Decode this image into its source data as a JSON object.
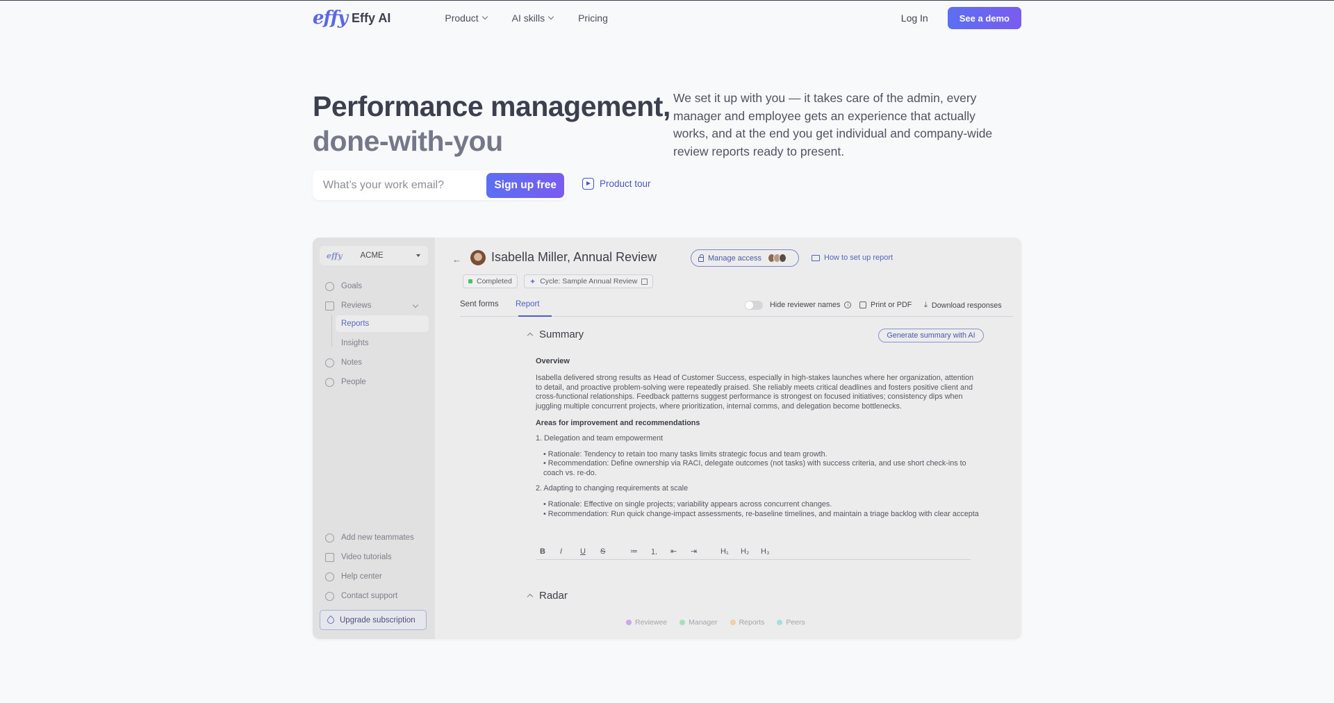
{
  "nav": {
    "logo_mark": "effy",
    "logo_text": "Effy AI",
    "links": [
      {
        "label": "Product",
        "dropdown": true
      },
      {
        "label": "AI skills",
        "dropdown": true
      },
      {
        "label": "Pricing",
        "dropdown": false
      }
    ],
    "login_label": "Log In",
    "demo_label": "See a demo"
  },
  "hero": {
    "title_line1": "Performance management,",
    "title_line2": "done-with-you",
    "description": "We set it up with you — it takes care of the admin, every manager and employee gets an experience that actually works, and at the end you get individual and company-wide review reports ready to present.",
    "email_placeholder": "What’s your work email?",
    "signup_label": "Sign up free",
    "tour_label": "Product tour"
  },
  "app": {
    "sidebar": {
      "org_logo": "effy",
      "org_name": "ACME",
      "items": [
        {
          "label": "Goals",
          "icon": "target-icon"
        },
        {
          "label": "Reviews",
          "icon": "clipboard-icon"
        },
        {
          "label": "Notes",
          "icon": "chat-icon"
        },
        {
          "label": "People",
          "icon": "people-icon"
        }
      ],
      "subitems": [
        {
          "label": "Reports",
          "active": true
        },
        {
          "label": "Insights",
          "active": false
        }
      ],
      "bottom_items": [
        {
          "label": "Add new teammates",
          "icon": "add-user-icon"
        },
        {
          "label": "Video tutorials",
          "icon": "video-icon"
        },
        {
          "label": "Help center",
          "icon": "help-icon"
        },
        {
          "label": "Contact support",
          "icon": "support-icon"
        }
      ],
      "upgrade_label": "Upgrade subscription"
    },
    "header": {
      "back": "←",
      "name": "Isabella Miller,",
      "review": "Annual Review",
      "manage_access": "Manage access",
      "how_to": "How to set up report",
      "status": "Completed",
      "cycle": "Cycle: Sample Annual Review"
    },
    "tabs": [
      "Sent forms",
      "Report"
    ],
    "active_tab": "Report",
    "toolbar": {
      "hide_names": "Hide reviewer names",
      "print": "Print or PDF",
      "download": "Download responses"
    },
    "summary": {
      "heading": "Summary",
      "generate_label": "Generate summary with AI",
      "overview_heading": "Overview",
      "overview_text": "Isabella delivered strong results as Head of Customer Success, especially in high-stakes launches where her organization, attention to detail, and proactive problem-solving were repeatedly praised. She reliably meets critical deadlines and fosters positive client and cross-functional relationships. Feedback patterns suggest performance is strongest on focused initiatives; consistency dips when juggling multiple concurrent projects, where prioritization, internal comms, and delegation become bottlenecks.",
      "areas_heading": "Areas for improvement and recommendations",
      "item1_title": "1. Delegation and team empowerment",
      "item1_b1": "• Rationale: Tendency to retain too many tasks limits strategic focus and team growth.",
      "item1_b2": "• Recommendation: Define ownership via RACI, delegate outcomes (not tasks) with success criteria, and use short check-ins to coach vs. re-do.",
      "item2_title": "2. Adapting to changing requirements at scale",
      "item2_b1": "• Rationale: Effective on single projects; variability appears across concurrent changes.",
      "item2_b2": "• Recommendation: Run quick change-impact assessments, re-baseline timelines, and maintain a triage backlog with clear accepta"
    },
    "editor_buttons": [
      "B",
      "I",
      "U",
      "S",
      "≔",
      "⒈",
      "⇤",
      "⇥",
      "H₁",
      "H₂",
      "H₃"
    ],
    "radar": {
      "heading": "Radar",
      "legend": [
        {
          "label": "Reviewee",
          "color": "#c9a8e8"
        },
        {
          "label": "Manager",
          "color": "#a8dfb8"
        },
        {
          "label": "Reports",
          "color": "#f0cfa0"
        },
        {
          "label": "Peers",
          "color": "#a8dde0"
        }
      ]
    }
  },
  "colors": {
    "accent": "#5b6ff2",
    "accent_end": "#7a5cf0",
    "link": "#4a55c8"
  }
}
